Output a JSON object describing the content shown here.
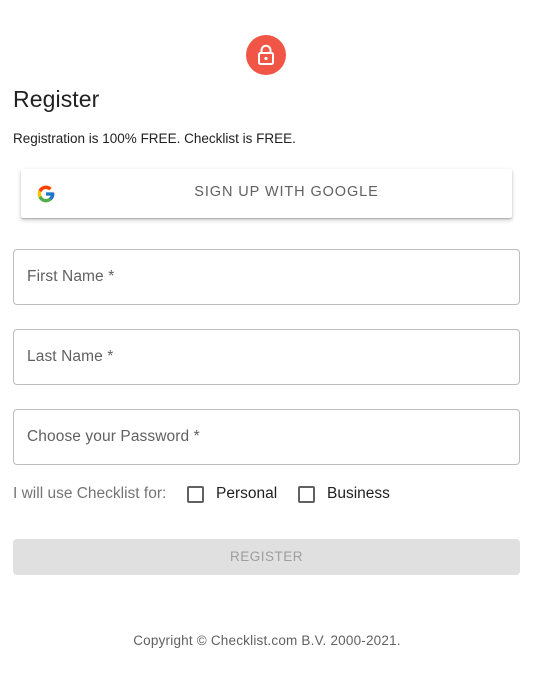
{
  "header": {
    "icon": "lock-icon",
    "icon_bg": "#f05545",
    "title": "Register",
    "subtitle": "Registration is 100% FREE. Checklist is FREE."
  },
  "google_button": {
    "icon": "google-logo-icon",
    "label": "SIGN UP WITH GOOGLE"
  },
  "form": {
    "first_name": {
      "label": "First Name *",
      "value": ""
    },
    "last_name": {
      "label": "Last Name *",
      "value": ""
    },
    "password": {
      "label": "Choose your Password *",
      "value": ""
    }
  },
  "usage": {
    "label": "I will use Checklist for:",
    "options": [
      {
        "label": "Personal",
        "checked": false
      },
      {
        "label": "Business",
        "checked": false
      }
    ]
  },
  "register_button": {
    "label": "REGISTER",
    "disabled": true
  },
  "footer": {
    "copyright": "Copyright © Checklist.com B.V. 2000-2021."
  }
}
